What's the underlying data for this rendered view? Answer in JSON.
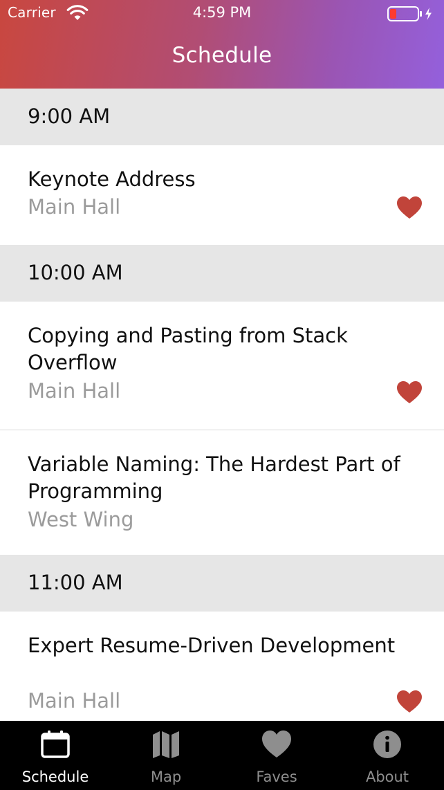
{
  "status_bar": {
    "carrier": "Carrier",
    "time": "4:59 PM"
  },
  "nav": {
    "title": "Schedule"
  },
  "sections": [
    {
      "time": "9:00 AM",
      "sessions": [
        {
          "title": "Keynote Address",
          "location": "Main Hall",
          "favorite": true
        }
      ]
    },
    {
      "time": "10:00 AM",
      "sessions": [
        {
          "title": "Copying and Pasting from Stack Overflow",
          "location": "Main Hall",
          "favorite": true
        },
        {
          "title": "Variable Naming: The Hardest Part of Programming",
          "location": "West Wing",
          "favorite": false
        }
      ]
    },
    {
      "time": "11:00 AM",
      "sessions": [
        {
          "title": "Expert Resume-Driven Development",
          "location": "Main Hall",
          "favorite": true
        }
      ]
    }
  ],
  "tabs": [
    {
      "label": "Schedule",
      "icon": "calendar-icon",
      "active": true
    },
    {
      "label": "Map",
      "icon": "map-icon",
      "active": false
    },
    {
      "label": "Faves",
      "icon": "heart-icon",
      "active": false
    },
    {
      "label": "About",
      "icon": "info-icon",
      "active": false
    }
  ],
  "colors": {
    "header_gradient_start": "#c9473f",
    "header_gradient_end": "#9460dc",
    "heart": "#c1443a",
    "section_background": "#e6e6e6",
    "location_text": "#9b9b9b",
    "tab_inactive": "#8e8e8e",
    "tab_active": "#ffffff"
  }
}
